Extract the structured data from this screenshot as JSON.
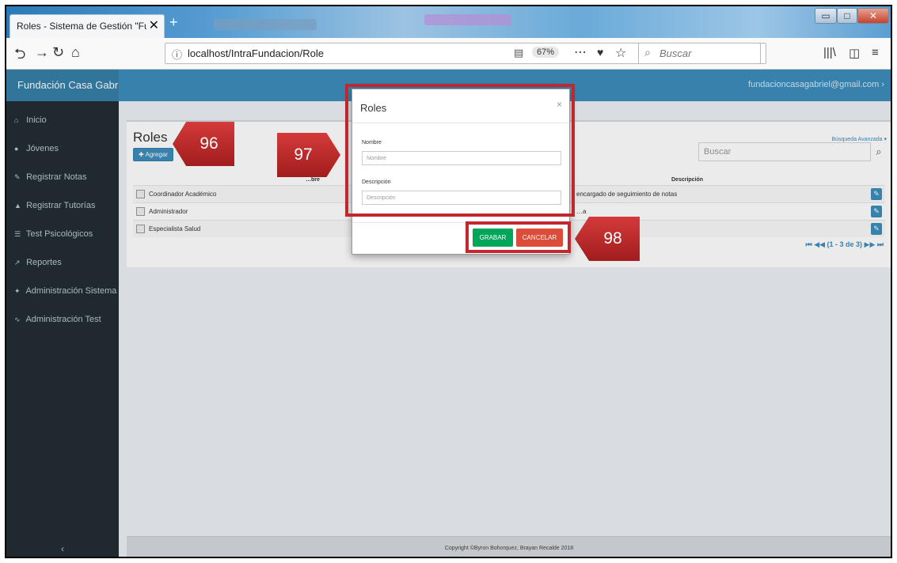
{
  "browser": {
    "tab_title": "Roles - Sistema de Gestión \"Fundac",
    "tab_close": "✕",
    "new_tab": "+",
    "url_info": "ⓘ",
    "url": "localhost/IntraFundacion/Role",
    "zoom": "67%",
    "search_placeholder": "Buscar",
    "icons": [
      "back-icon",
      "forward-icon",
      "reload-icon",
      "home-icon",
      "reader-icon",
      "more-icon",
      "pocket-icon",
      "bookmark-star-icon",
      "library-icon",
      "sidebar-icon",
      "menu-icon"
    ]
  },
  "app": {
    "brand": "Fundación Casa Gabriel",
    "user_email": "fundacioncasagabriel@gmail.com ›"
  },
  "sidebar": {
    "items": [
      {
        "icon": "home-icon",
        "label": "Inicio"
      },
      {
        "icon": "user-icon",
        "label": "Jóvenes"
      },
      {
        "icon": "edit-icon",
        "label": "Registrar Notas"
      },
      {
        "icon": "graduation-cap-icon",
        "label": "Registrar Tutorías"
      },
      {
        "icon": "list-icon",
        "label": "Test Psicológicos"
      },
      {
        "icon": "chart-icon",
        "label": "Reportes"
      },
      {
        "icon": "wrench-icon",
        "label": "Administración Sistema"
      },
      {
        "icon": "psych-icon",
        "label": "Administración Test"
      }
    ],
    "toggle": "‹"
  },
  "page": {
    "title": "Roles",
    "add_label": "✚ Agregar",
    "advanced_search": "Búsqueda Avanzada ▾",
    "search_placeholder": "Buscar",
    "col_name": "…bre",
    "col_desc": "Descripción",
    "rows": [
      {
        "name": "Coordinador Académico",
        "desc": "encargado de seguimiento de notas"
      },
      {
        "name": "Administrador",
        "desc": "…a"
      },
      {
        "name": "Especialista Salud",
        "desc": ""
      }
    ],
    "pager": "⏮ ◀◀ (1 - 3 de 3) ▶▶ ⏭"
  },
  "footer": "Copyright ©Byron Bohorquez, Brayan Recalde 2018",
  "modal": {
    "title": "Roles",
    "close": "×",
    "nombre_label": "Nombre",
    "nombre_placeholder": "Nombre",
    "descripcion_label": "Descripción",
    "descripcion_placeholder": "Descripción",
    "save_label": "GRABAR",
    "cancel_label": "CANCELAR"
  },
  "annotations": [
    "96",
    "97",
    "98"
  ],
  "colors": {
    "accent": "#3c8dbc",
    "sidebar": "#222d32",
    "save": "#00a65a",
    "cancel": "#dd4b39",
    "highlight": "#c0282d"
  }
}
